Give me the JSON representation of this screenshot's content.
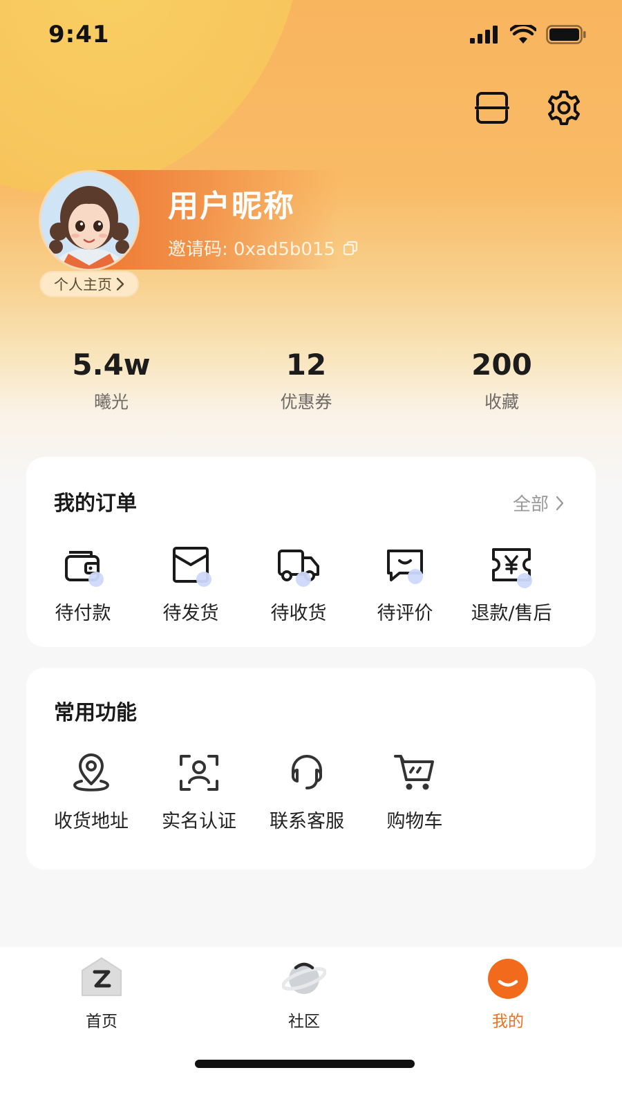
{
  "status_bar": {
    "time": "9:41"
  },
  "profile": {
    "nickname": "用户昵称",
    "invite_code": "邀请码: 0xad5b015",
    "home_link": "个人主页"
  },
  "stats": [
    {
      "value": "5.4w",
      "label": "曦光"
    },
    {
      "value": "12",
      "label": "优惠券"
    },
    {
      "value": "200",
      "label": "收藏"
    }
  ],
  "orders": {
    "title": "我的订单",
    "see_all": "全部",
    "items": [
      {
        "label": "待付款",
        "icon": "wallet-icon"
      },
      {
        "label": "待发货",
        "icon": "package-icon"
      },
      {
        "label": "待收货",
        "icon": "truck-icon"
      },
      {
        "label": "待评价",
        "icon": "comment-icon"
      },
      {
        "label": "退款/售后",
        "icon": "refund-ticket-icon"
      }
    ]
  },
  "functions": {
    "title": "常用功能",
    "items": [
      {
        "label": "收货地址",
        "icon": "location-pin-icon"
      },
      {
        "label": "实名认证",
        "icon": "face-scan-icon"
      },
      {
        "label": "联系客服",
        "icon": "headset-icon"
      },
      {
        "label": "购物车",
        "icon": "shopping-cart-icon"
      }
    ]
  },
  "tabbar": {
    "items": [
      {
        "label": "首页",
        "icon": "home-icon",
        "active": false
      },
      {
        "label": "社区",
        "icon": "planet-icon",
        "active": false
      },
      {
        "label": "我的",
        "icon": "smile-icon",
        "active": true
      }
    ]
  },
  "colors": {
    "accent": "#F07020",
    "header_gradient_top": "#F9B45E",
    "icon_dot": "#CDD9FB"
  }
}
